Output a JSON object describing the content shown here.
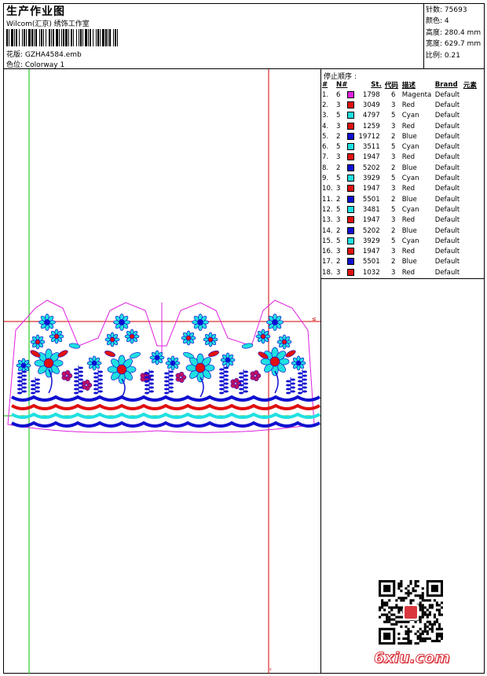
{
  "header": {
    "title": "生产作业图",
    "subtitle": "Wilcom(汇京) 绣饰工作室",
    "design_label": "花版: GZHA4584.emb",
    "colorway_label": "色位: Colorway 1"
  },
  "stats": [
    {
      "label": "针数",
      "value": "75693"
    },
    {
      "label": "颜色",
      "value": "4"
    },
    {
      "label": "高度",
      "value": "280.4 mm"
    },
    {
      "label": "宽度",
      "value": "629.7 mm"
    },
    {
      "label": "比例",
      "value": "0.21"
    }
  ],
  "sequence": {
    "title": "停止顺序 :",
    "headers": [
      "#",
      "N#",
      "St.",
      "代码",
      "描述",
      "Brand",
      "元素"
    ],
    "rows": [
      {
        "n": "1.",
        "needle": "6",
        "color": "#e020e0",
        "st": "1798",
        "code": "6",
        "desc": "Magenta",
        "brand": "Default"
      },
      {
        "n": "2.",
        "needle": "3",
        "color": "#e01010",
        "st": "3049",
        "code": "3",
        "desc": "Red",
        "brand": "Default"
      },
      {
        "n": "3.",
        "needle": "5",
        "color": "#20e0e0",
        "st": "4797",
        "code": "5",
        "desc": "Cyan",
        "brand": "Default"
      },
      {
        "n": "4.",
        "needle": "3",
        "color": "#e01010",
        "st": "1259",
        "code": "3",
        "desc": "Red",
        "brand": "Default"
      },
      {
        "n": "5.",
        "needle": "2",
        "color": "#1010d0",
        "st": "19712",
        "code": "2",
        "desc": "Blue",
        "brand": "Default"
      },
      {
        "n": "6.",
        "needle": "5",
        "color": "#20e0e0",
        "st": "3511",
        "code": "5",
        "desc": "Cyan",
        "brand": "Default"
      },
      {
        "n": "7.",
        "needle": "3",
        "color": "#e01010",
        "st": "1947",
        "code": "3",
        "desc": "Red",
        "brand": "Default"
      },
      {
        "n": "8.",
        "needle": "2",
        "color": "#1010d0",
        "st": "5202",
        "code": "2",
        "desc": "Blue",
        "brand": "Default"
      },
      {
        "n": "9.",
        "needle": "5",
        "color": "#20e0e0",
        "st": "3929",
        "code": "5",
        "desc": "Cyan",
        "brand": "Default"
      },
      {
        "n": "10.",
        "needle": "3",
        "color": "#e01010",
        "st": "1947",
        "code": "3",
        "desc": "Red",
        "brand": "Default"
      },
      {
        "n": "11.",
        "needle": "2",
        "color": "#1010d0",
        "st": "5501",
        "code": "2",
        "desc": "Blue",
        "brand": "Default"
      },
      {
        "n": "12.",
        "needle": "5",
        "color": "#20e0e0",
        "st": "3481",
        "code": "5",
        "desc": "Cyan",
        "brand": "Default"
      },
      {
        "n": "13.",
        "needle": "3",
        "color": "#e01010",
        "st": "1947",
        "code": "3",
        "desc": "Red",
        "brand": "Default"
      },
      {
        "n": "14.",
        "needle": "2",
        "color": "#1010d0",
        "st": "5202",
        "code": "2",
        "desc": "Blue",
        "brand": "Default"
      },
      {
        "n": "15.",
        "needle": "5",
        "color": "#20e0e0",
        "st": "3929",
        "code": "5",
        "desc": "Cyan",
        "brand": "Default"
      },
      {
        "n": "16.",
        "needle": "3",
        "color": "#e01010",
        "st": "1947",
        "code": "3",
        "desc": "Red",
        "brand": "Default"
      },
      {
        "n": "17.",
        "needle": "2",
        "color": "#1010d0",
        "st": "5501",
        "code": "2",
        "desc": "Blue",
        "brand": "Default"
      },
      {
        "n": "18.",
        "needle": "3",
        "color": "#e01010",
        "st": "1032",
        "code": "3",
        "desc": "Red",
        "brand": "Default"
      }
    ]
  },
  "watermark": "6xiu.com",
  "colors": {
    "guide_green": "#00c000",
    "guide_red": "#d00000",
    "outline_magenta": "#e020e0"
  }
}
